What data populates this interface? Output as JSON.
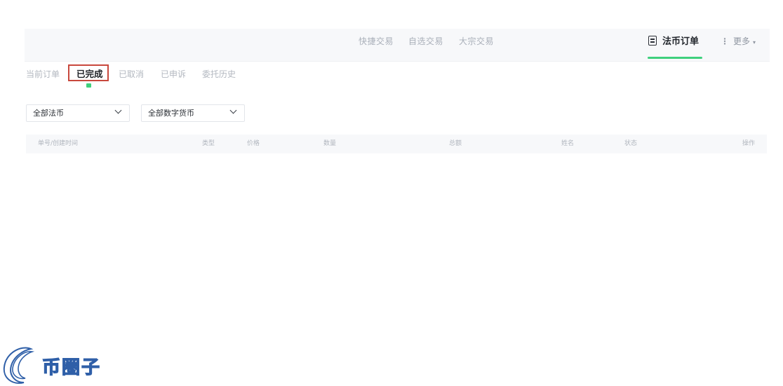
{
  "nav": {
    "links": [
      "快捷交易",
      "自选交易",
      "大宗交易"
    ],
    "fiat_orders": "法币订单",
    "more": "更多",
    "more_caret": "▾",
    "kebab": "⋮"
  },
  "tabs": {
    "current": "当前订单",
    "done": "已完成",
    "cancelled": "已取消",
    "appealed": "已申诉",
    "history": "委托历史",
    "active": "done"
  },
  "filters": {
    "fiat": "全部法币",
    "coin": "全部数字货币"
  },
  "table": {
    "headers": [
      "单号/创建时间",
      "类型",
      "价格",
      "数量",
      "总额",
      "姓名",
      "状态",
      "操作"
    ]
  },
  "watermark": {
    "text": "币圈子"
  },
  "colors": {
    "accent": "#3fd07d",
    "highlight": "#c8483d",
    "logo_blue": "#2f5fa8"
  }
}
